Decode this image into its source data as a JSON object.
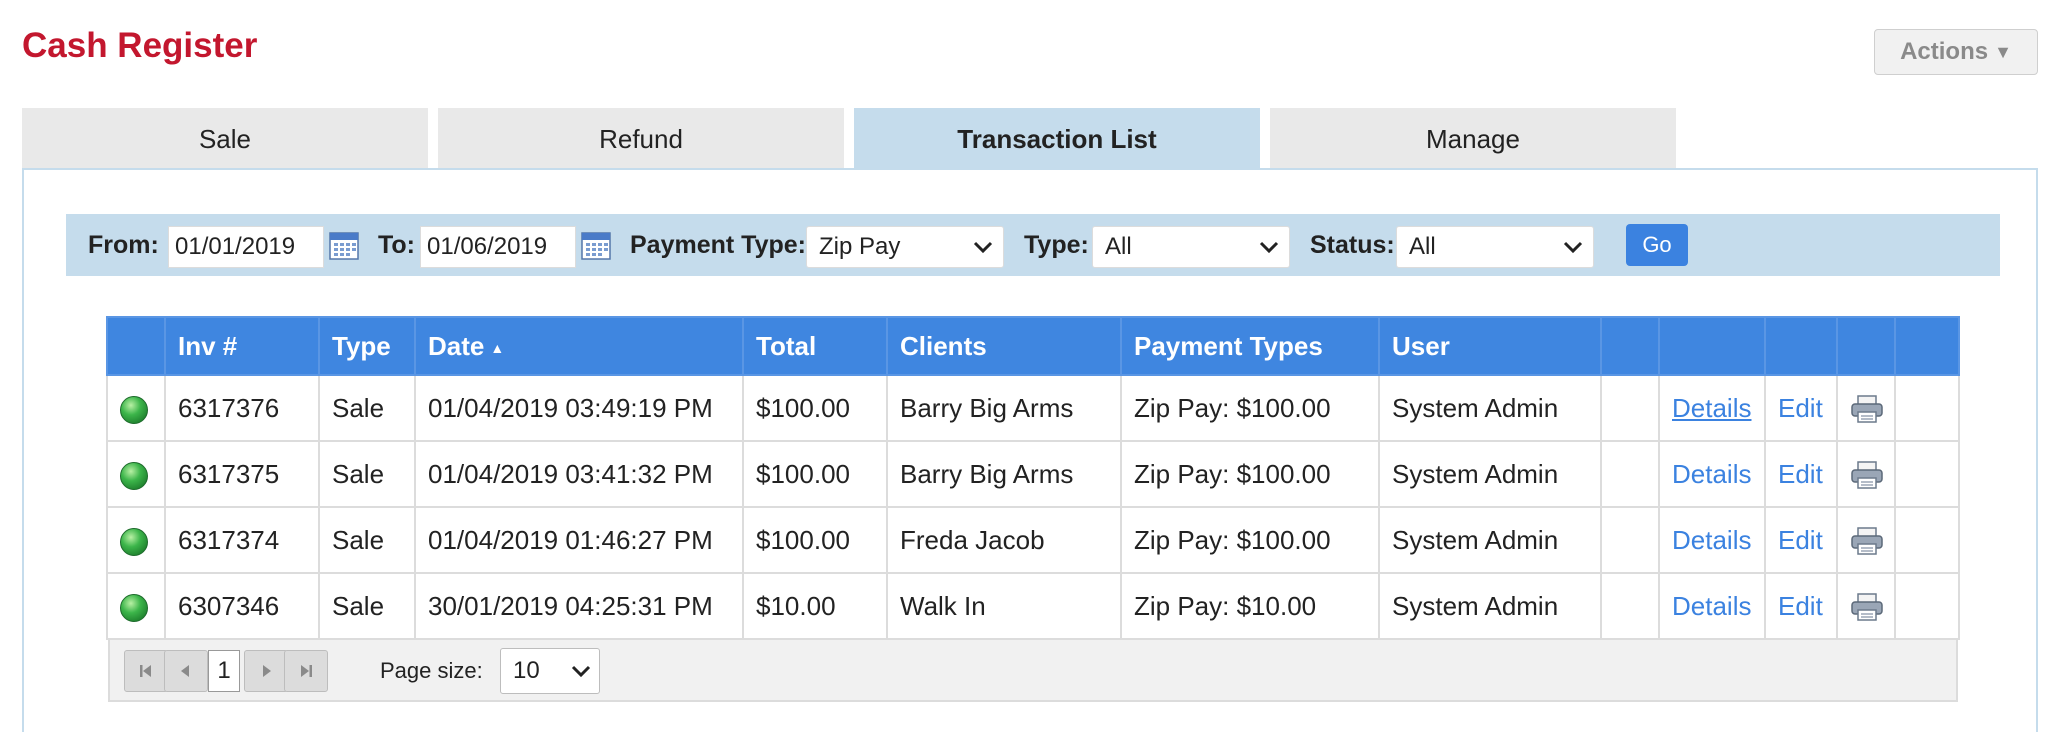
{
  "page": {
    "title": "Cash Register",
    "actions_label": "Actions"
  },
  "tabs": [
    {
      "label": "Sale",
      "active": false
    },
    {
      "label": "Refund",
      "active": false
    },
    {
      "label": "Transaction List",
      "active": true
    },
    {
      "label": "Manage",
      "active": false
    }
  ],
  "filters": {
    "from_label": "From:",
    "from_value": "01/01/2019",
    "to_label": "To:",
    "to_value": "01/06/2019",
    "payment_type_label": "Payment Type:",
    "payment_type_value": "Zip Pay",
    "type_label": "Type:",
    "type_value": "All",
    "status_label": "Status:",
    "status_value": "All",
    "go_label": "Go"
  },
  "table": {
    "columns": [
      "",
      "Inv #",
      "Type",
      "Date",
      "Total",
      "Clients",
      "Payment Types",
      "User",
      "",
      "",
      "",
      "",
      ""
    ],
    "rows": [
      {
        "inv": "6317376",
        "type": "Sale",
        "date": "01/04/2019 03:49:19 PM",
        "total": "$100.00",
        "client": "Barry Big Arms",
        "payment": "Zip Pay: $100.00",
        "user": "System Admin",
        "details": "Details",
        "edit": "Edit"
      },
      {
        "inv": "6317375",
        "type": "Sale",
        "date": "01/04/2019 03:41:32 PM",
        "total": "$100.00",
        "client": "Barry Big Arms",
        "payment": "Zip Pay: $100.00",
        "user": "System Admin",
        "details": "Details",
        "edit": "Edit"
      },
      {
        "inv": "6317374",
        "type": "Sale",
        "date": "01/04/2019 01:46:27 PM",
        "total": "$100.00",
        "client": "Freda Jacob",
        "payment": "Zip Pay: $100.00",
        "user": "System Admin",
        "details": "Details",
        "edit": "Edit"
      },
      {
        "inv": "6307346",
        "type": "Sale",
        "date": "30/01/2019 04:25:31 PM",
        "total": "$10.00",
        "client": "Walk In",
        "payment": "Zip Pay: $10.00",
        "user": "System Admin",
        "details": "Details",
        "edit": "Edit"
      }
    ]
  },
  "pager": {
    "current_page": "1",
    "page_size_label": "Page size:",
    "page_size_value": "10"
  },
  "colors": {
    "title": "#c3172e",
    "tab_active": "#c5dcec",
    "header": "#3f86e0",
    "link": "#3b82e0",
    "status_ok": "#3cb54a"
  },
  "icons": {
    "calendar": "calendar-icon",
    "status": "status-green-dot-icon",
    "print": "printer-icon",
    "first": "first-page-icon",
    "prev": "prev-page-icon",
    "next": "next-page-icon",
    "last": "last-page-icon"
  }
}
